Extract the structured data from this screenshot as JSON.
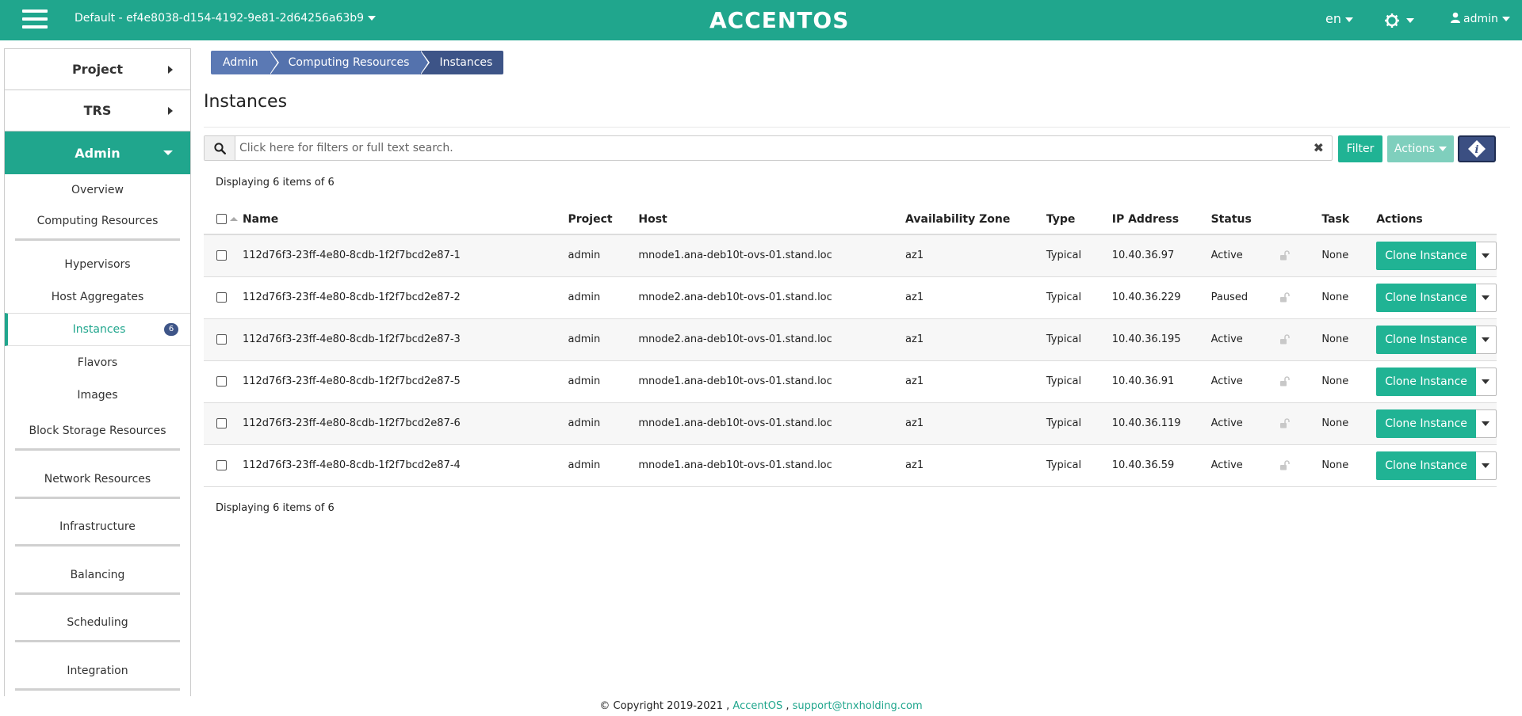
{
  "header": {
    "project_selector": "Default - ef4e8038-d154-4192-9e81-2d64256a63b9",
    "logo": "ACCENTOS",
    "language": "en",
    "user": "admin"
  },
  "sidebar": {
    "project": "Project",
    "trs": "TRS",
    "admin": "Admin",
    "items": [
      {
        "label": "Overview"
      },
      {
        "label": "Computing Resources"
      },
      {
        "label": "Hypervisors"
      },
      {
        "label": "Host Aggregates"
      },
      {
        "label": "Instances",
        "badge": "6"
      },
      {
        "label": "Flavors"
      },
      {
        "label": "Images"
      },
      {
        "label": "Block Storage Resources"
      },
      {
        "label": "Network Resources"
      },
      {
        "label": "Infrastructure"
      },
      {
        "label": "Balancing"
      },
      {
        "label": "Scheduling"
      },
      {
        "label": "Integration"
      }
    ]
  },
  "breadcrumb": [
    "Admin",
    "Computing Resources",
    "Instances"
  ],
  "page_title": "Instances",
  "search": {
    "placeholder": "Click here for filters or full text search."
  },
  "buttons": {
    "filter": "Filter",
    "actions": "Actions"
  },
  "display_count": "Displaying 6 items of 6",
  "table": {
    "headers": {
      "name": "Name",
      "project": "Project",
      "host": "Host",
      "zone": "Availability Zone",
      "type": "Type",
      "ip": "IP Address",
      "status": "Status",
      "task": "Task",
      "actions": "Actions"
    },
    "action_label": "Clone Instance",
    "rows": [
      {
        "name": "112d76f3-23ff-4e80-8cdb-1f2f7bcd2e87-1",
        "project": "admin",
        "host": "mnode1.ana-deb10t-ovs-01.stand.loc",
        "zone": "az1",
        "type": "Typical",
        "ip": "10.40.36.97",
        "status": "Active",
        "task": "None"
      },
      {
        "name": "112d76f3-23ff-4e80-8cdb-1f2f7bcd2e87-2",
        "project": "admin",
        "host": "mnode2.ana-deb10t-ovs-01.stand.loc",
        "zone": "az1",
        "type": "Typical",
        "ip": "10.40.36.229",
        "status": "Paused",
        "task": "None"
      },
      {
        "name": "112d76f3-23ff-4e80-8cdb-1f2f7bcd2e87-3",
        "project": "admin",
        "host": "mnode2.ana-deb10t-ovs-01.stand.loc",
        "zone": "az1",
        "type": "Typical",
        "ip": "10.40.36.195",
        "status": "Active",
        "task": "None"
      },
      {
        "name": "112d76f3-23ff-4e80-8cdb-1f2f7bcd2e87-5",
        "project": "admin",
        "host": "mnode1.ana-deb10t-ovs-01.stand.loc",
        "zone": "az1",
        "type": "Typical",
        "ip": "10.40.36.91",
        "status": "Active",
        "task": "None"
      },
      {
        "name": "112d76f3-23ff-4e80-8cdb-1f2f7bcd2e87-6",
        "project": "admin",
        "host": "mnode1.ana-deb10t-ovs-01.stand.loc",
        "zone": "az1",
        "type": "Typical",
        "ip": "10.40.36.119",
        "status": "Active",
        "task": "None"
      },
      {
        "name": "112d76f3-23ff-4e80-8cdb-1f2f7bcd2e87-4",
        "project": "admin",
        "host": "mnode1.ana-deb10t-ovs-01.stand.loc",
        "zone": "az1",
        "type": "Typical",
        "ip": "10.40.36.59",
        "status": "Active",
        "task": "None"
      }
    ]
  },
  "footer": {
    "copyright": "© Copyright 2019-2021 ,",
    "brand_link": "AccentOS",
    "separator": ",",
    "email": "support@tnxholding.com"
  }
}
